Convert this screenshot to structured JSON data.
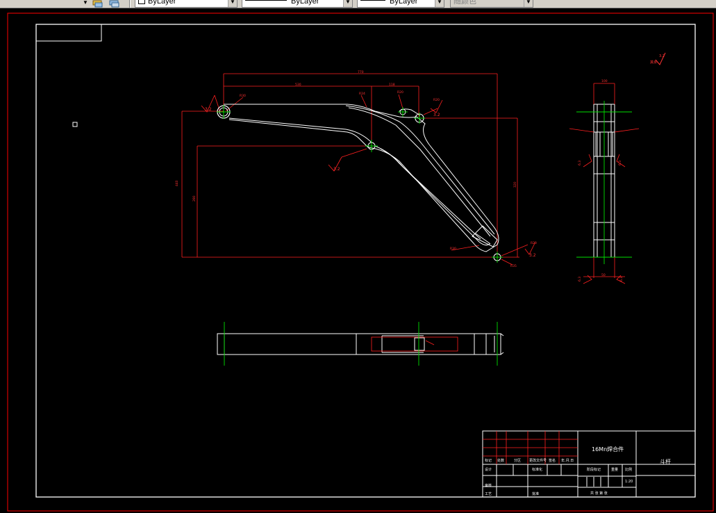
{
  "toolbar": {
    "layer_combo": "ByLayer",
    "linetype_combo": "ByLayer",
    "lineweight_combo": "ByLayer",
    "plotstyle_combo": "随颜色"
  },
  "drawing": {
    "roughness_general": "3.2",
    "roughness_corner": "其余",
    "roughness_corner_value": "3.2"
  },
  "title_block": {
    "material": "16Mn焊合件",
    "part_name": "斗杆",
    "scale": "1:20",
    "row_headers": [
      "标记",
      "处数",
      "分区",
      "更改文件号",
      "签名",
      "年.月.日"
    ],
    "design_label": "设计",
    "standardize_label": "标准化",
    "check_label": "审核",
    "process_label": "工艺",
    "approve_label": "批准",
    "stage_label": "阶段标记",
    "weight_label": "重量",
    "scale_label": "比例",
    "sheet_info": "共 张 第 张"
  }
}
